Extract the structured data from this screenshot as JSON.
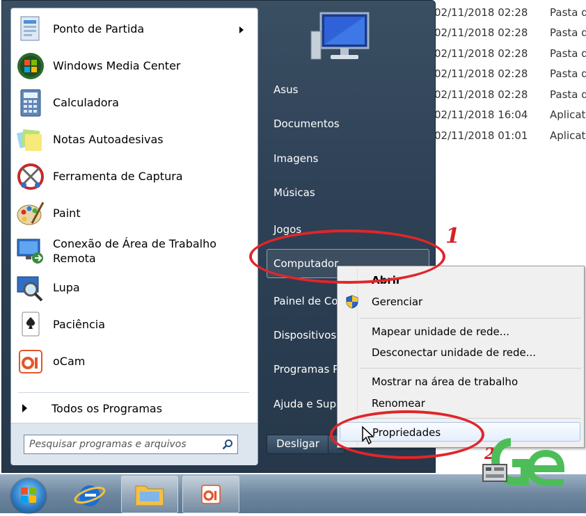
{
  "explorer": {
    "rows": [
      {
        "date": "02/11/2018 02:28",
        "type": "Pasta d"
      },
      {
        "date": "02/11/2018 02:28",
        "type": "Pasta d"
      },
      {
        "date": "02/11/2018 02:28",
        "type": "Pasta d"
      },
      {
        "date": "02/11/2018 02:28",
        "type": "Pasta d"
      },
      {
        "date": "02/11/2018 02:28",
        "type": "Pasta d"
      },
      {
        "date": "02/11/2018 16:04",
        "type": "Aplicat"
      },
      {
        "date": "02/11/2018 01:01",
        "type": "Aplicat"
      }
    ]
  },
  "start_menu": {
    "programs": [
      {
        "label": "Ponto de Partida",
        "icon": "getting-started-icon"
      },
      {
        "label": "Windows Media Center",
        "icon": "media-center-icon"
      },
      {
        "label": "Calculadora",
        "icon": "calculator-icon"
      },
      {
        "label": "Notas Autoadesivas",
        "icon": "sticky-notes-icon"
      },
      {
        "label": "Ferramenta de Captura",
        "icon": "snipping-tool-icon"
      },
      {
        "label": "Paint",
        "icon": "paint-icon"
      },
      {
        "label": "Conexão de Área de Trabalho Remota",
        "icon": "remote-desktop-icon"
      },
      {
        "label": "Lupa",
        "icon": "magnifier-icon"
      },
      {
        "label": "Paciência",
        "icon": "solitaire-icon"
      },
      {
        "label": "oCam",
        "icon": "ocam-icon"
      }
    ],
    "all_programs": "Todos os Programas",
    "search_placeholder": "Pesquisar programas e arquivos",
    "right_items": [
      "Asus",
      "Documentos",
      "Imagens",
      "Músicas",
      "Jogos",
      "Computador",
      "Painel de Co",
      "Dispositivos",
      "Programas P",
      "Ajuda e Supo"
    ],
    "shutdown": "Desligar"
  },
  "context_menu": {
    "items": [
      "Abrir",
      "Gerenciar",
      "Mapear unidade de rede...",
      "Desconectar unidade de rede...",
      "Mostrar na área de trabalho",
      "Renomear",
      "Propriedades"
    ]
  },
  "annotations": {
    "marker_1": "1",
    "marker_2": "2"
  },
  "colors": {
    "accent_red": "#e0262b",
    "menu_dark": "#2e4156"
  }
}
